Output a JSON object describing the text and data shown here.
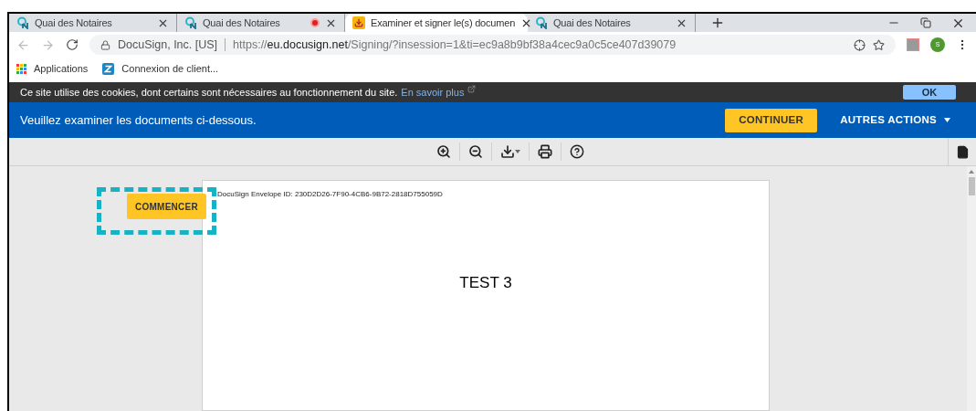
{
  "tabs": [
    {
      "label": "Quai des Notaires",
      "selected": false,
      "recording": false,
      "kind": "site"
    },
    {
      "label": "Quai des Notaires",
      "selected": false,
      "recording": true,
      "kind": "site"
    },
    {
      "label": "Examiner et signer le(s) documen",
      "selected": true,
      "recording": false,
      "kind": "download"
    },
    {
      "label": "Quai des Notaires",
      "selected": false,
      "recording": false,
      "kind": "site"
    }
  ],
  "address": {
    "site": "DocuSign, Inc. [US]",
    "url_prefix": "https://",
    "url_host": "eu.docusign.net",
    "url_path": "/Signing/?insession=1&ti=ec9a8b9bf38a4cec9a0c5ce407d39079"
  },
  "profile": {
    "initial": "S"
  },
  "bookmarks": [
    {
      "label": "Applications",
      "kind": "apps"
    },
    {
      "label": "Connexion de client...",
      "kind": "z"
    }
  ],
  "cookie_bar": {
    "text": "Ce site utilise des cookies, dont certains sont nécessaires au fonctionnement du site.",
    "link": "En savoir plus",
    "button": "OK"
  },
  "action_bar": {
    "message": "Veuillez examiner les documents ci-dessous.",
    "continue_button": "CONTINUER",
    "more_actions": "AUTRES ACTIONS"
  },
  "document": {
    "start_button": "COMMENCER",
    "start_highlighted": true,
    "envelope_id": "DocuSign Envelope ID: 230D2D26-7F90-4CB6-9B72-2818D755059D",
    "title": "TEST 3"
  }
}
